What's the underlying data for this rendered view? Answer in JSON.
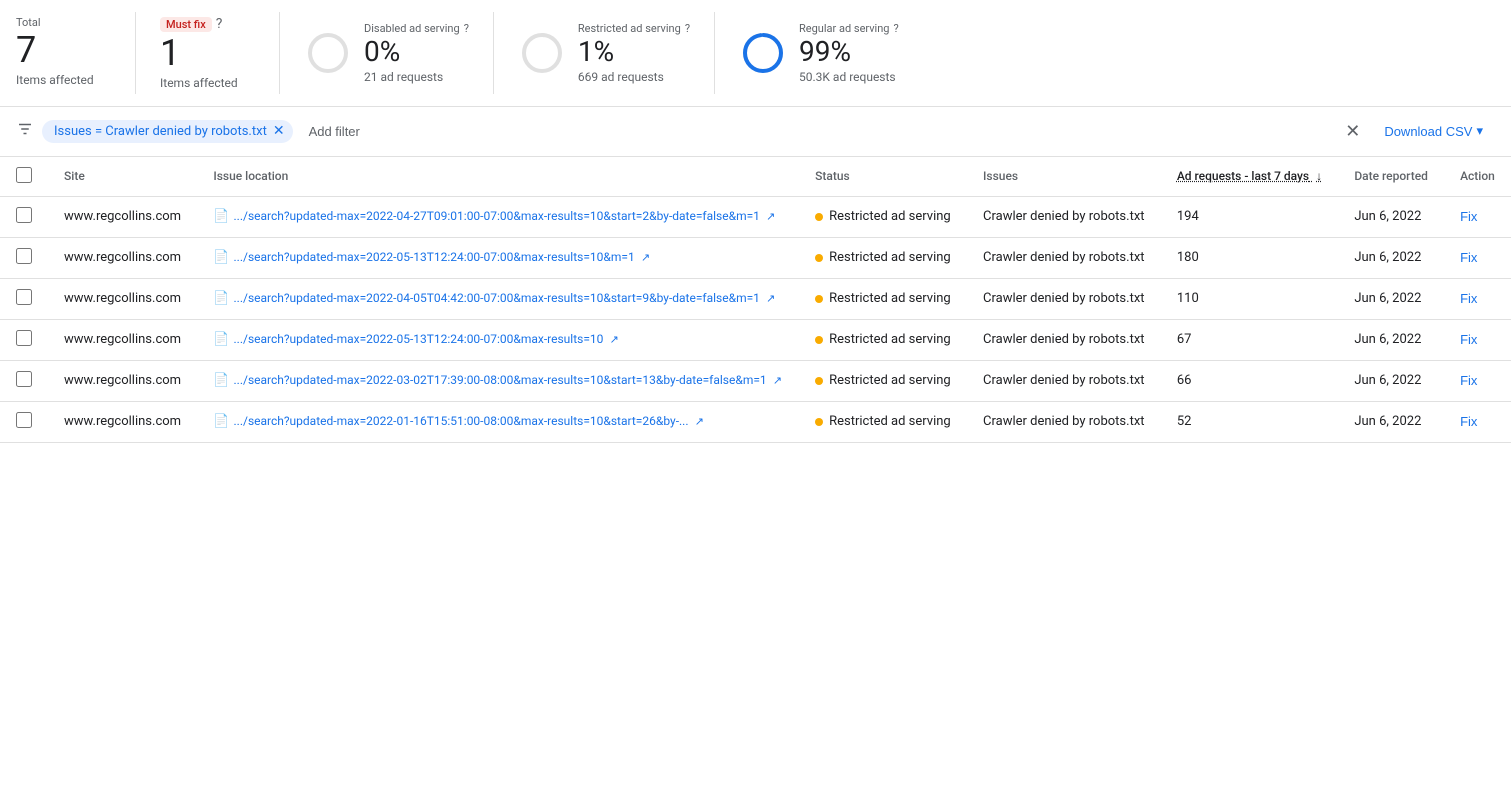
{
  "stats": {
    "total": {
      "label_top": "Total",
      "number": "7",
      "label_bottom": "Items affected"
    },
    "must_fix": {
      "badge": "Must fix",
      "help_icon": "?",
      "number": "1",
      "label_bottom": "Items affected"
    },
    "disabled_ad": {
      "label_top": "Disabled ad serving",
      "help_icon": "?",
      "percent": "0%",
      "requests": "21 ad requests",
      "circle_color": "#e0e0e0",
      "fill_percent": 0
    },
    "restricted_ad": {
      "label_top": "Restricted ad serving",
      "help_icon": "?",
      "percent": "1%",
      "requests": "669 ad requests",
      "circle_color": "#e0e0e0",
      "fill_percent": 1
    },
    "regular_ad": {
      "label_top": "Regular ad serving",
      "help_icon": "?",
      "percent": "99%",
      "requests": "50.3K ad requests",
      "circle_color": "#1a73e8",
      "fill_percent": 99
    }
  },
  "filter": {
    "icon": "≡",
    "chip_text": "Issues = Crawler denied by robots.txt",
    "add_filter": "Add filter",
    "close_icon": "×",
    "download_csv": "Download CSV",
    "download_arrow": "▾"
  },
  "table": {
    "columns": {
      "site": "Site",
      "issue_location": "Issue location",
      "status": "Status",
      "issues": "Issues",
      "ad_requests": "Ad requests - last 7 days",
      "date_reported": "Date reported",
      "action": "Action"
    },
    "rows": [
      {
        "site": "www.regcollins.com",
        "issue_location": ".../search?updated-max=2022-04-27T09:01:00-07:00&max-results=10&start=2&by-date=false&m=1",
        "status": "Restricted ad serving",
        "issues": "Crawler denied by robots.txt",
        "ad_requests": "194",
        "date_reported": "Jun 6, 2022",
        "action": "Fix"
      },
      {
        "site": "www.regcollins.com",
        "issue_location": ".../search?updated-max=2022-05-13T12:24:00-07:00&max-results=10&m=1",
        "status": "Restricted ad serving",
        "issues": "Crawler denied by robots.txt",
        "ad_requests": "180",
        "date_reported": "Jun 6, 2022",
        "action": "Fix"
      },
      {
        "site": "www.regcollins.com",
        "issue_location": ".../search?updated-max=2022-04-05T04:42:00-07:00&max-results=10&start=9&by-date=false&m=1",
        "status": "Restricted ad serving",
        "issues": "Crawler denied by robots.txt",
        "ad_requests": "110",
        "date_reported": "Jun 6, 2022",
        "action": "Fix"
      },
      {
        "site": "www.regcollins.com",
        "issue_location": ".../search?updated-max=2022-05-13T12:24:00-07:00&max-results=10",
        "status": "Restricted ad serving",
        "issues": "Crawler denied by robots.txt",
        "ad_requests": "67",
        "date_reported": "Jun 6, 2022",
        "action": "Fix"
      },
      {
        "site": "www.regcollins.com",
        "issue_location": ".../search?updated-max=2022-03-02T17:39:00-08:00&max-results=10&start=13&by-date=false&m=1",
        "status": "Restricted ad serving",
        "issues": "Crawler denied by robots.txt",
        "ad_requests": "66",
        "date_reported": "Jun 6, 2022",
        "action": "Fix"
      },
      {
        "site": "www.regcollins.com",
        "issue_location": ".../search?updated-max=2022-01-16T15:51:00-08:00&max-results=10&start=26&by-...",
        "status": "Restricted ad serving",
        "issues": "Crawler denied by robots.txt",
        "ad_requests": "52",
        "date_reported": "Jun 6, 2022",
        "action": "Fix"
      }
    ],
    "sort_arrow": "↓"
  },
  "colors": {
    "blue": "#1a73e8",
    "orange": "#f9ab00",
    "red": "#c5221f",
    "gray": "#5f6368",
    "light_gray": "#e0e0e0"
  }
}
